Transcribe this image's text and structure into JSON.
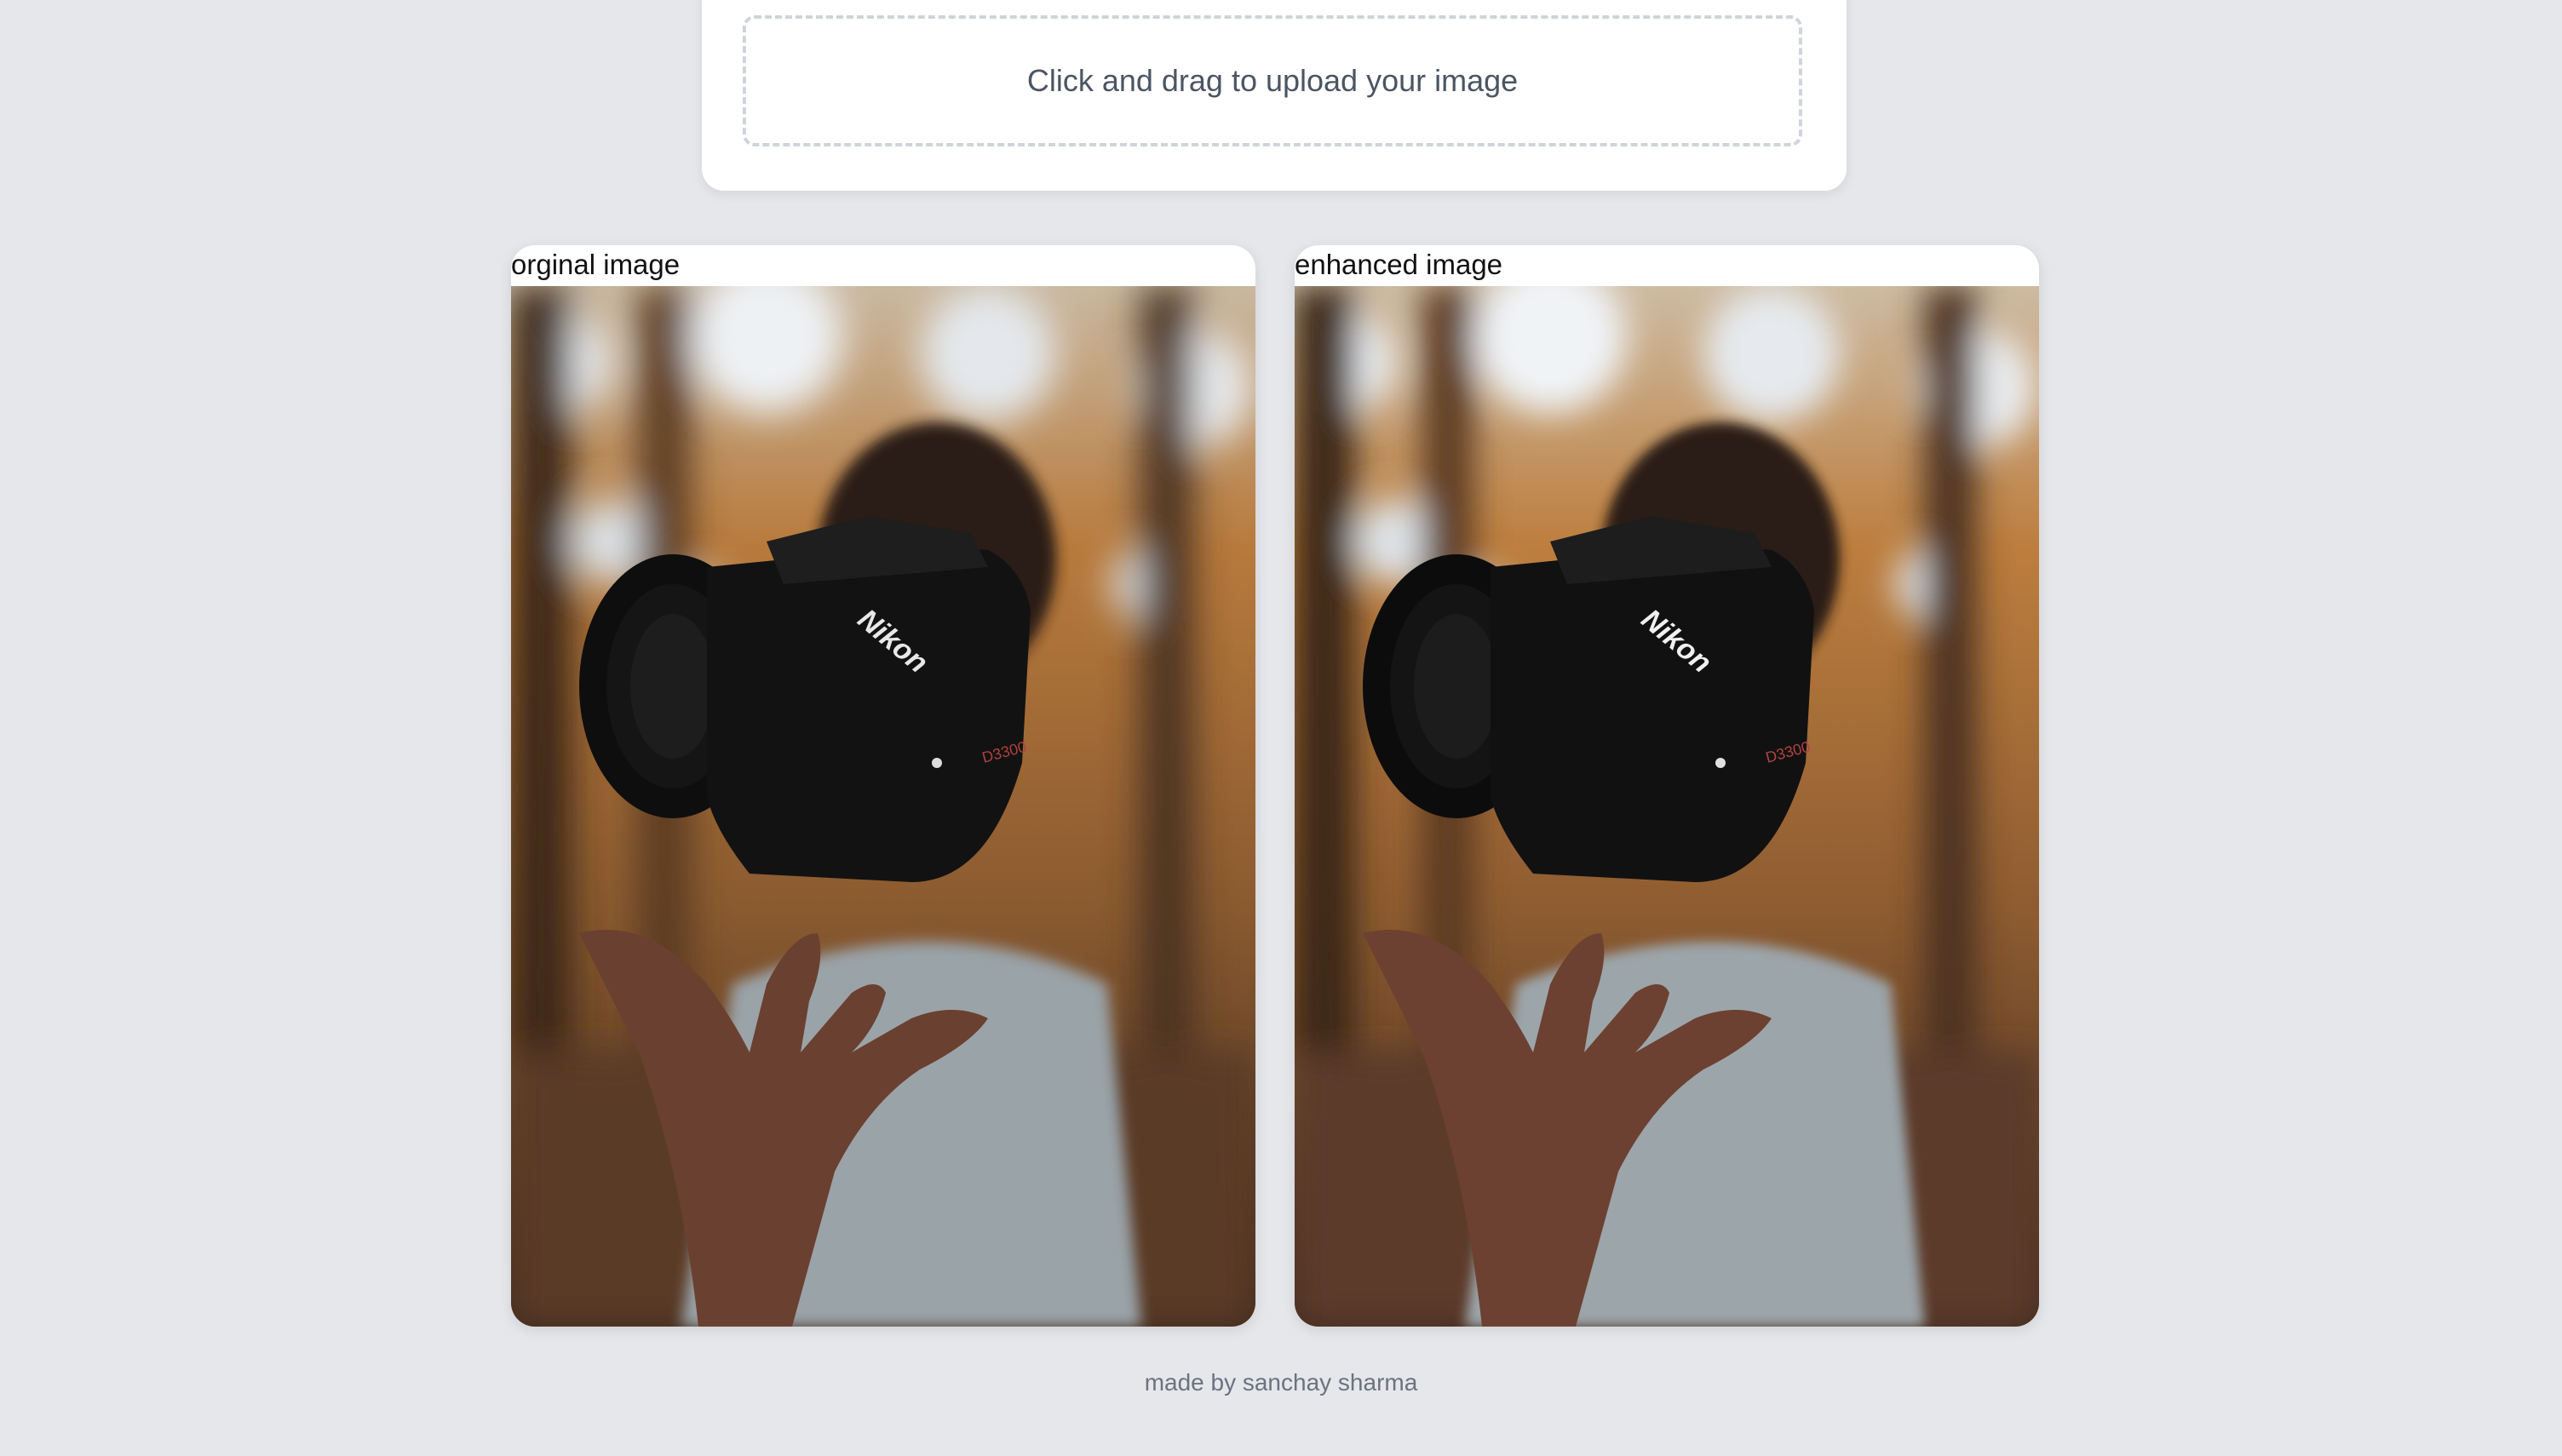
{
  "upload": {
    "prompt": "Click and drag to upload your image"
  },
  "panels": [
    {
      "title": "orginal image",
      "camera_brand": "Nikon",
      "camera_model": "D3300"
    },
    {
      "title": "enhanced image",
      "camera_brand": "Nikon",
      "camera_model": "D3300"
    }
  ],
  "footer": {
    "credit": "made by sanchay sharma"
  },
  "colors": {
    "page_background": "#e5e7eb",
    "card_background": "#ffffff",
    "dropzone_border": "#cfd3da",
    "prompt_text": "#4b5563",
    "footer_text": "#6b7280"
  }
}
